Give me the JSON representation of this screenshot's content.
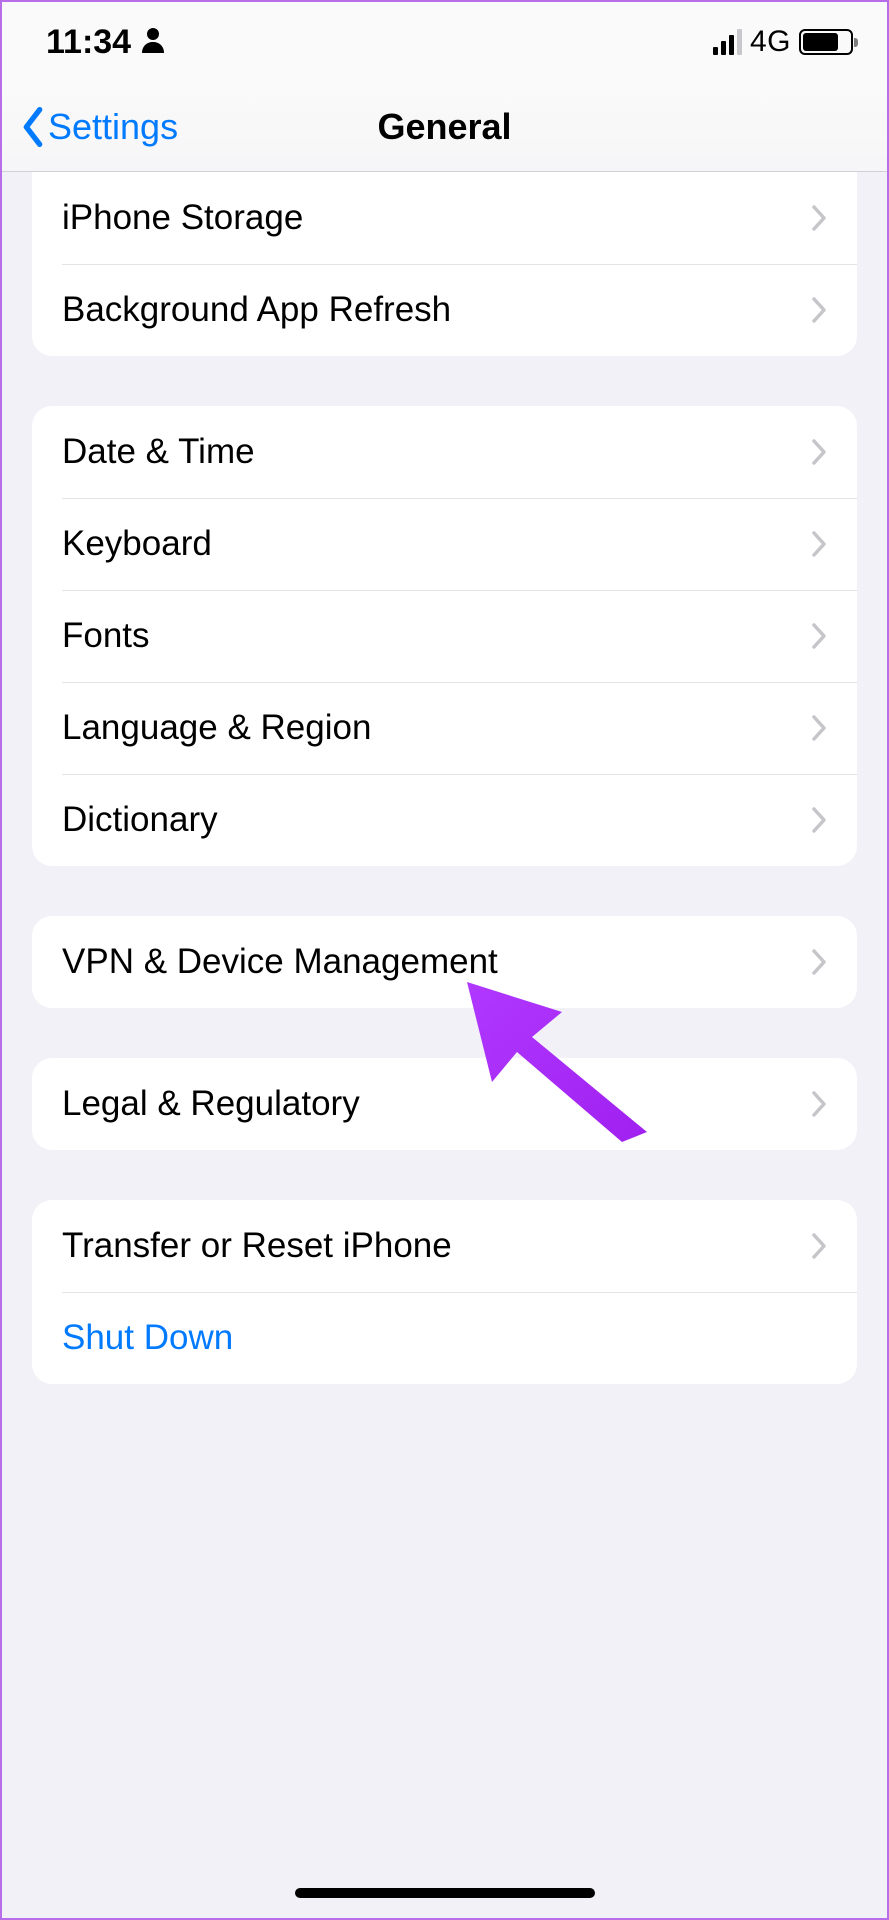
{
  "status": {
    "time": "11:34",
    "network": "4G"
  },
  "nav": {
    "back": "Settings",
    "title": "General"
  },
  "groups": [
    {
      "id": "storage",
      "first": true,
      "rows": [
        {
          "id": "iphone-storage",
          "label": "iPhone Storage",
          "chevron": true
        },
        {
          "id": "background-app-refresh",
          "label": "Background App Refresh",
          "chevron": true
        }
      ]
    },
    {
      "id": "locale",
      "rows": [
        {
          "id": "date-time",
          "label": "Date & Time",
          "chevron": true
        },
        {
          "id": "keyboard",
          "label": "Keyboard",
          "chevron": true
        },
        {
          "id": "fonts",
          "label": "Fonts",
          "chevron": true
        },
        {
          "id": "language-region",
          "label": "Language & Region",
          "chevron": true
        },
        {
          "id": "dictionary",
          "label": "Dictionary",
          "chevron": true
        }
      ]
    },
    {
      "id": "vpn",
      "rows": [
        {
          "id": "vpn-device-management",
          "label": "VPN & Device Management",
          "chevron": true
        }
      ]
    },
    {
      "id": "legal",
      "rows": [
        {
          "id": "legal-regulatory",
          "label": "Legal & Regulatory",
          "chevron": true
        }
      ]
    },
    {
      "id": "reset",
      "rows": [
        {
          "id": "transfer-reset",
          "label": "Transfer or Reset iPhone",
          "chevron": true
        },
        {
          "id": "shut-down",
          "label": "Shut Down",
          "chevron": false,
          "action": true
        }
      ]
    }
  ]
}
